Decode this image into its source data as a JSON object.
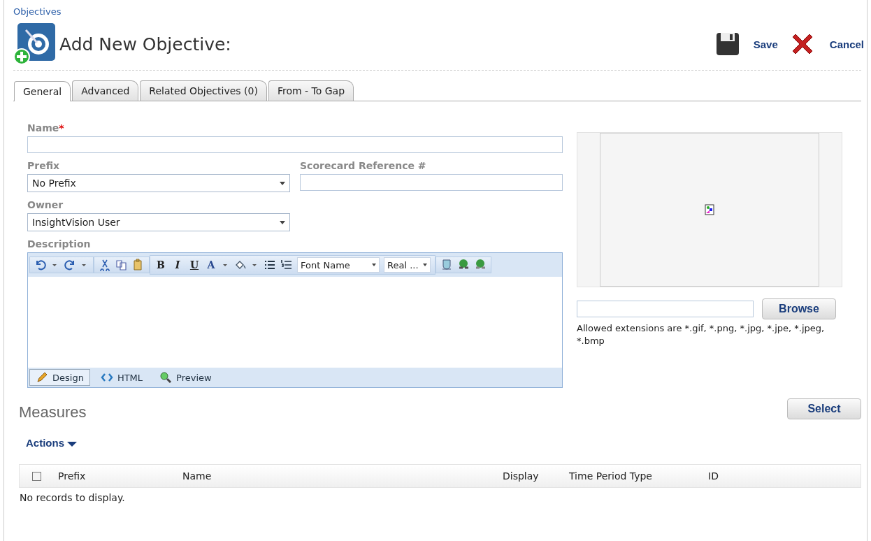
{
  "breadcrumb": "Objectives",
  "title": "Add New Objective:",
  "actions": [
    {
      "kind": "save",
      "label": "Save"
    },
    {
      "kind": "cancel",
      "label": "Cancel"
    }
  ],
  "tabs": [
    {
      "label": "General",
      "selected": true
    },
    {
      "label": "Advanced",
      "selected": false
    },
    {
      "label": "Related Objectives (0)",
      "selected": false
    },
    {
      "label": "From - To Gap",
      "selected": false
    }
  ],
  "form": {
    "name": {
      "label": "Name",
      "required_mark": "*"
    },
    "prefix": {
      "label": "Prefix",
      "value": "No Prefix"
    },
    "scorecard_ref": {
      "label": "Scorecard Reference #"
    },
    "owner": {
      "label": "Owner",
      "value": "InsightVision User"
    },
    "description": {
      "label": "Description"
    }
  },
  "editor": {
    "toolbar": [
      [
        {
          "kind": "undo",
          "caret": true
        },
        {
          "kind": "redo",
          "caret": true
        }
      ],
      [
        {
          "kind": "cut"
        },
        {
          "kind": "copy"
        },
        {
          "kind": "paste"
        }
      ],
      [
        {
          "kind": "bold",
          "glyph": "B"
        },
        {
          "kind": "italic",
          "glyph": "I"
        },
        {
          "kind": "underline",
          "glyph": "U"
        },
        {
          "kind": "forecolor",
          "glyph": "A",
          "caret": true
        },
        {
          "kind": "backcolor",
          "caret": true
        },
        {
          "kind": "bullets"
        },
        {
          "kind": "numbering"
        },
        {
          "kind": "select",
          "value": "Font Name"
        },
        {
          "kind": "select",
          "value": "Real ..."
        }
      ],
      [
        {
          "kind": "image"
        },
        {
          "kind": "link"
        },
        {
          "kind": "unlink"
        }
      ]
    ],
    "modes": [
      {
        "kind": "design",
        "label": "Design",
        "selected": true
      },
      {
        "kind": "html",
        "label": "HTML",
        "selected": false
      },
      {
        "kind": "preview",
        "label": "Preview",
        "selected": false
      }
    ]
  },
  "image": {
    "browse": "Browse",
    "note": "Allowed extensions are *.gif, *.png, *.jpg, *.jpe, *.jpeg, *.bmp"
  },
  "measures": {
    "title": "Measures",
    "select": "Select",
    "actions": "Actions",
    "select_all_checked": false,
    "columns": [
      "Prefix",
      "Name",
      "Display",
      "Time Period Type",
      "ID"
    ],
    "empty": "No records to display."
  }
}
